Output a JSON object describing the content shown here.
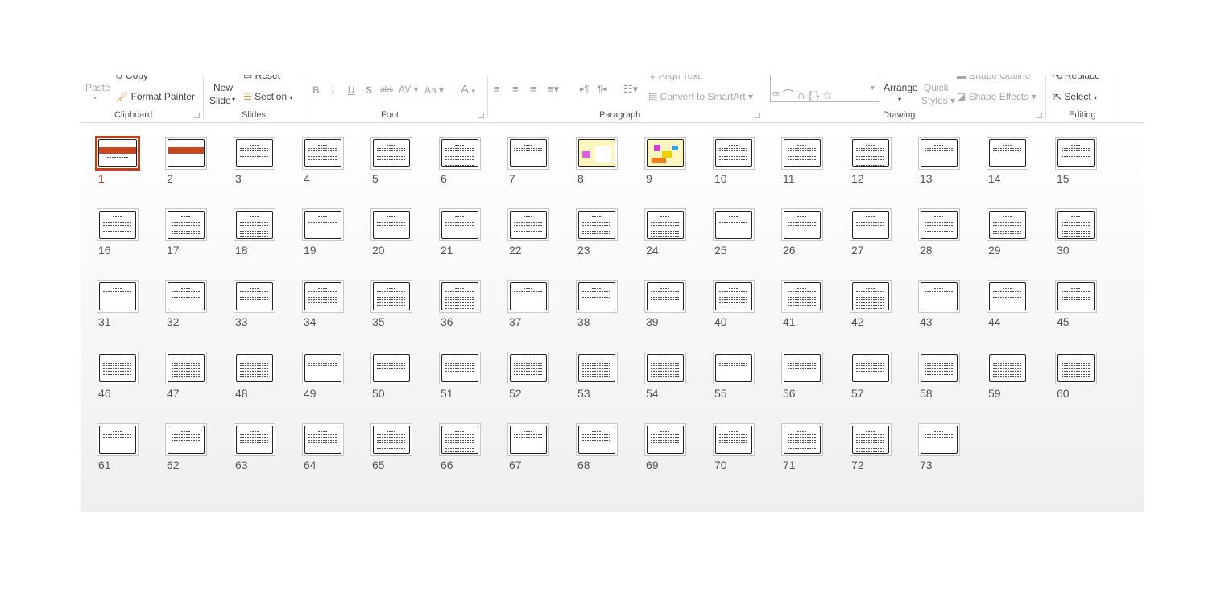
{
  "ribbon": {
    "clipboard": {
      "paste": "Paste",
      "copy": "Copy",
      "format_painter": "Format Painter",
      "label": "Clipboard"
    },
    "slides": {
      "new_slide_1": "New",
      "new_slide_2": "Slide",
      "reset": "Reset",
      "section": "Section",
      "label": "Slides"
    },
    "font": {
      "bold": "B",
      "italic": "I",
      "underline": "U",
      "shadow": "S",
      "strike": "abc",
      "spacing": "AV",
      "case": "Aa",
      "color": "A",
      "label": "Font"
    },
    "paragraph": {
      "align_text": "Align Text",
      "smartart": "Convert to SmartArt",
      "label": "Paragraph"
    },
    "drawing": {
      "arrange": "Arrange",
      "quick_1": "Quick",
      "quick_2": "Styles",
      "shape_outline": "Shape Outline",
      "shape_effects": "Shape Effects",
      "label": "Drawing"
    },
    "editing": {
      "replace": "Replace",
      "select": "Select",
      "label": "Editing"
    }
  },
  "sorter": {
    "selected": 1,
    "accent": "#c43e1c",
    "styles": {
      "1": "title",
      "2": "title-band",
      "8": "yellow",
      "9": "yellow-chart"
    },
    "slides": [
      "1",
      "2",
      "3",
      "4",
      "5",
      "6",
      "7",
      "8",
      "9",
      "10",
      "11",
      "12",
      "13",
      "14",
      "15",
      "16",
      "17",
      "18",
      "19",
      "20",
      "21",
      "22",
      "23",
      "24",
      "25",
      "26",
      "27",
      "28",
      "29",
      "30",
      "31",
      "32",
      "33",
      "34",
      "35",
      "36",
      "37",
      "38",
      "39",
      "40",
      "41",
      "42",
      "43",
      "44",
      "45",
      "46",
      "47",
      "48",
      "49",
      "50",
      "51",
      "52",
      "53",
      "54",
      "55",
      "56",
      "57",
      "58",
      "59",
      "60",
      "61",
      "62",
      "63",
      "64",
      "65",
      "66",
      "67",
      "68",
      "69",
      "70",
      "71",
      "72",
      "73"
    ]
  }
}
